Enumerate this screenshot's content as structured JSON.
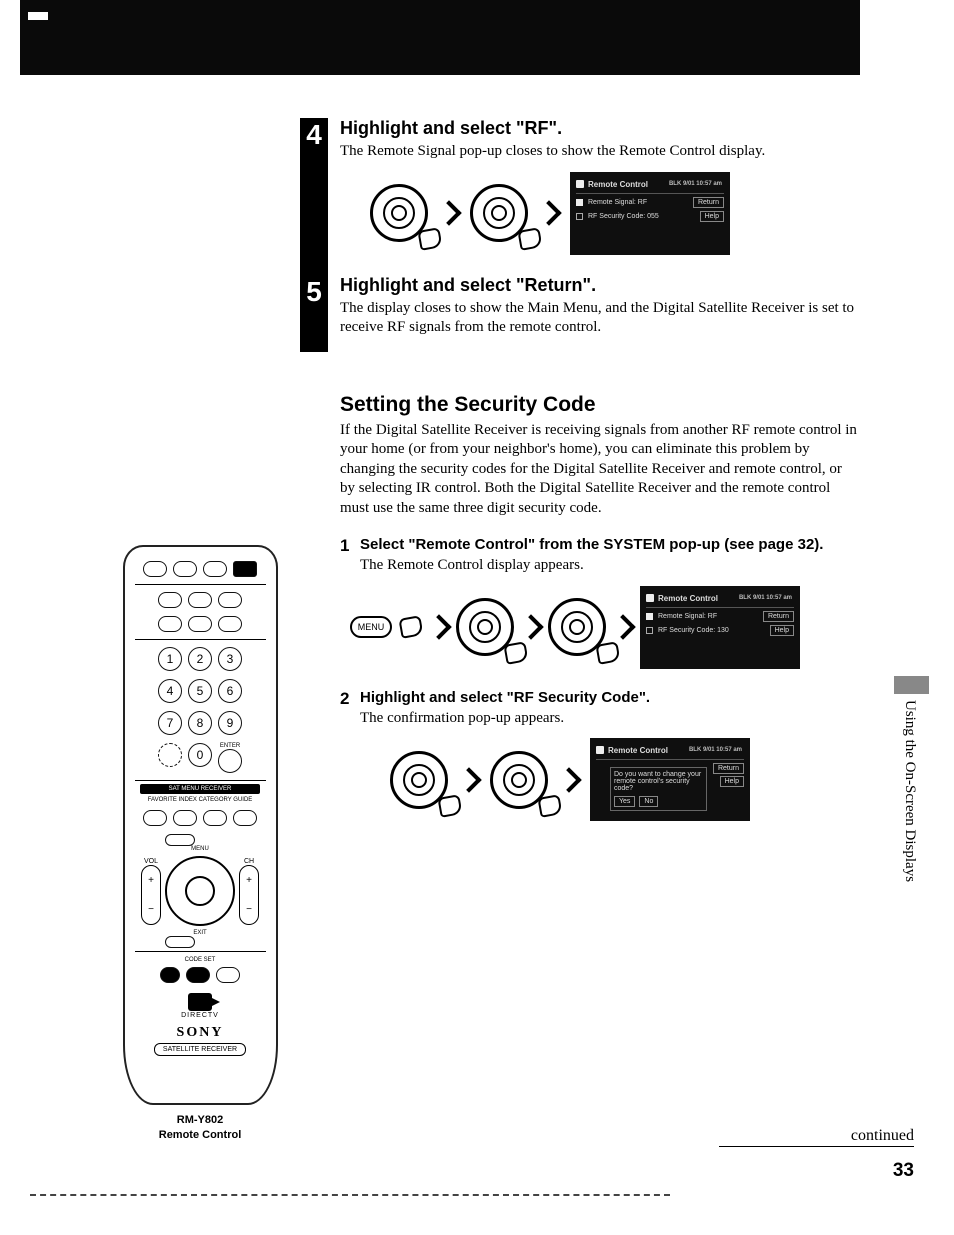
{
  "page_number": "33",
  "side_label": "Using the On-Screen Displays",
  "continued": "continued",
  "step4": {
    "number": "4",
    "heading": "Highlight and select \"RF\".",
    "body": "The Remote Signal pop-up closes to show the Remote Control display.",
    "screen": {
      "title": "Remote Control",
      "time": "BLK 9/01 10:57 am",
      "row1": "Remote Signal: RF",
      "row2": "RF Security Code: 055",
      "btn1": "Return",
      "btn2": "Help"
    }
  },
  "step5": {
    "number": "5",
    "heading": "Highlight and select \"Return\".",
    "body": "The display closes to show the Main Menu, and the Digital Satellite Receiver is set to receive RF signals from the remote control."
  },
  "section": {
    "heading": "Setting the Security Code",
    "intro": "If the Digital Satellite Receiver is receiving signals from another RF remote control in your home (or from your neighbor's home), you can eliminate this problem by changing the security codes for the Digital Satellite Receiver and remote control, or by selecting IR control. Both the Digital Satellite Receiver and the remote control must use the same three digit security code."
  },
  "sub1": {
    "num": "1",
    "heading": "Select \"Remote Control\" from the SYSTEM pop-up (see page 32).",
    "body": "The Remote Control display appears.",
    "menu_label": "MENU",
    "screen": {
      "title": "Remote Control",
      "time": "BLK 9/01 10:57 am",
      "row1": "Remote Signal: RF",
      "row2": "RF Security Code: 130",
      "btn1": "Return",
      "btn2": "Help"
    }
  },
  "sub2": {
    "num": "2",
    "heading": "Highlight and select \"RF Security Code\".",
    "body": "The confirmation pop-up appears.",
    "screen": {
      "title": "Remote Control",
      "time": "BLK 9/01 10:57 am",
      "confirm": "Do you want to change your remote control's security code?",
      "btn1": "Return",
      "btn2": "Help",
      "yes": "Yes",
      "no": "No"
    }
  },
  "remote": {
    "numbers": [
      "1",
      "2",
      "3",
      "4",
      "5",
      "6",
      "7",
      "8",
      "9",
      "0"
    ],
    "enter": "ENTER",
    "strip": "SAT MENU  RECEIVER",
    "labels_top": "FAVORITE  INDEX  CATEGORY  GUIDE",
    "vol": "VOL",
    "ch": "CH",
    "menu": "MENU",
    "exit": "EXIT",
    "codeset": "CODE SET",
    "directv": "DIRECTV",
    "brand": "SONY",
    "sublabel": "SATELLITE RECEIVER",
    "caption_line1": "RM-Y802",
    "caption_line2": "Remote Control"
  }
}
